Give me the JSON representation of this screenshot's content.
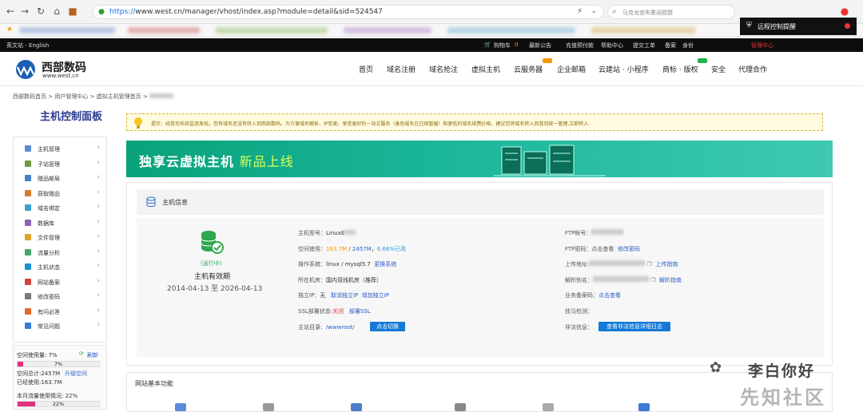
{
  "browser": {
    "url_protocol": "https://",
    "url_rest": "www.west.cn/manager/vhost/index.asp?module=detail&sid=524547",
    "search_text": "马克龙宣布重返欧盟"
  },
  "remote_popup": {
    "label": "远程控制提醒"
  },
  "topbar": {
    "lang": "英文站 - English",
    "cart": "购物车",
    "cart_count": "0",
    "notice": "最新公告",
    "recharge": "充值预付款",
    "help": "帮助中心",
    "ticket": "提交工单",
    "note": "备案",
    "identity": "身份",
    "manage": "管理中心"
  },
  "header": {
    "logo_name": "西部数码",
    "logo_url": "www.west.cn",
    "nav": [
      "首页",
      "域名注册",
      "域名抢注",
      "虚拟主机",
      "云服务器",
      "企业邮箱",
      "云建站 · 小程序",
      "商标 · 版权",
      "安全",
      "代理合作"
    ]
  },
  "breadcrumb": [
    "西部数码首页",
    "用户管理中心",
    "虚拟主机管理首页"
  ],
  "sidebar": {
    "title": "主机控制面板",
    "items": [
      "主机管理",
      "子站管理",
      "赠品邮局",
      "获取赠品",
      "域名绑定",
      "数据库",
      "文件管理",
      "流量分析",
      "主机状态",
      "网站备案",
      "修改密码",
      "有问必答",
      "常见问题"
    ],
    "colors": [
      "#5b8bd9",
      "#6a9a3a",
      "#4a7fc8",
      "#d67c2a",
      "#3aa0d0",
      "#8a63b8",
      "#e2a12a",
      "#4aa66a",
      "#1f8fd0",
      "#d14444",
      "#7a7a7a",
      "#e06a2a",
      "#3a7bd5"
    ]
  },
  "usage": {
    "space_used_label": "空间使用量: 7%",
    "refresh": "刷新",
    "space_pct": "7%",
    "space_total": "空间总计:2457M",
    "upgrade": "升级空间",
    "space_used": "已经使用:163.7M",
    "traffic_label": "本月流量使用情况: 22%",
    "traffic_pct": "22%",
    "space_fraction": 0.07,
    "traffic_fraction": 0.22
  },
  "tip": {
    "text": "提示：经我司系统监测发现，您有域名还没有转入到西部数码。为方便域名解析、IP变更、享受更好的一站式服务（备色域名在已续暂缓）和更低的域名续费价格，建议您将域名转入到我司统一管理,立即转入"
  },
  "banner": {
    "title": "独享云虚拟主机",
    "subtitle": "新品上线"
  },
  "host": {
    "panel_title": "主机信息",
    "status": "(运行中)",
    "valid_label": "主机有效期",
    "valid_range": "2014-04-13 至 2026-04-13",
    "model_label": "主机型号：",
    "model_value": "LinuxE",
    "space_label": "空间使用：",
    "space_used": "163.7M",
    "space_total": "2457M",
    "space_pct": "6.66%已用",
    "os_label": "操作系统：",
    "os_value": "linux / mysql5.7",
    "os_link": "更换系统",
    "room_label": "所在机房：",
    "room_value": "国内双线机房（推荐）",
    "ip_label": "独立IP：",
    "ip_value": "无",
    "ip_link1": "取消独立IP",
    "ip_link2": "增加独立IP",
    "ssl_label": "SSL部署状态:",
    "ssl_value": "关闭",
    "ssl_link": "部署SSL",
    "dir_label": "主站目录:",
    "dir_value": "/wwwroot/",
    "dir_btn": "点击切换",
    "ftp_label": "FTP帐号：",
    "ftp_pwd_label": "FTP密码：",
    "ftp_pwd_link1": "点击查看",
    "ftp_pwd_link2": "修改密码",
    "upload_label": "上传地址:",
    "upload_link": "上传指南",
    "alias_label": "解析别名：",
    "alias_link": "解析指南",
    "biz_label": "业务备案码：",
    "biz_link": "点击查看",
    "hang_label": "挂马检测：",
    "illegal_label": "非法信息：",
    "illegal_btn": "查看非法信息详细日志"
  },
  "basic": {
    "title": "网站基本功能"
  },
  "watermark": {
    "line1": "李白你好",
    "line2": "先知社区"
  }
}
